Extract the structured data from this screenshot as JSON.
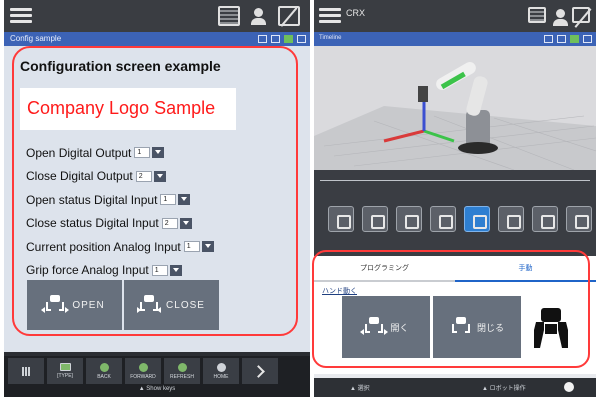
{
  "left": {
    "config_title_bar": "Config sample",
    "screen_title": "Configuration screen example",
    "logo_text": "Company Logo Sample",
    "settings": [
      {
        "label": "Open Digital Output",
        "value": "1"
      },
      {
        "label": "Close Digital Output",
        "value": "2"
      },
      {
        "label": "Open status Digital Input",
        "value": "1"
      },
      {
        "label": "Close status Digital Input",
        "value": "2"
      },
      {
        "label": "Current position Analog Input",
        "value": "1"
      },
      {
        "label": "Grip force Analog Input",
        "value": "1"
      }
    ],
    "open_button": "OPEN",
    "close_button": "CLOSE",
    "keys": {
      "type": "[TYPE]",
      "back": "BACK",
      "forward": "FORWARD",
      "refresh": "REFRESH",
      "home": "HOME"
    },
    "show_keys": "▲ Show keys"
  },
  "right": {
    "app_title": "CRX",
    "sub_title": "Timeline",
    "tabs": [
      "プログラミング",
      "手動"
    ],
    "hand_label": "ハンド動く",
    "open_button": "開く",
    "close_button": "閉じる",
    "status_left": "▲    選択",
    "status_right": "▲  ロボット操作"
  },
  "colors": {
    "accent_blue": "#3c63b6",
    "highlight_red": "#ff3a3a",
    "logo_red": "#ff1a1a",
    "button_gray": "#67707d"
  }
}
